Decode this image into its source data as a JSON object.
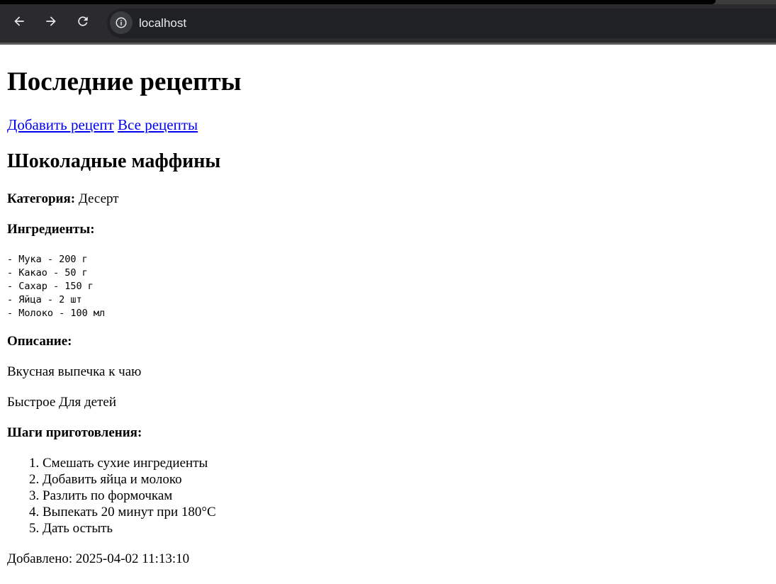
{
  "browser": {
    "url": "localhost",
    "back_icon": "arrow-left-icon",
    "forward_icon": "arrow-right-icon",
    "reload_icon": "reload-icon",
    "info_icon": "info-icon"
  },
  "page": {
    "title": "Последние рецепты",
    "nav_links": [
      "Добавить рецепт",
      "Все рецепты"
    ],
    "recipe": {
      "name": "Шоколадные маффины",
      "category_label": "Категория:",
      "category_value": "Десерт",
      "ingredients_label": "Ингредиенты:",
      "ingredients": [
        "- Мука - 200 г",
        "- Какао - 50 г",
        "- Сахар - 150 г",
        "- Яйца - 2 шт",
        "- Молоко - 100 мл"
      ],
      "description_label": "Описание:",
      "description": "Вкусная выпечка к чаю",
      "tags": "Быстрое Для детей",
      "steps_label": "Шаги приготовления:",
      "steps": [
        "Смешать сухие ингредиенты",
        "Добавить яйца и молоко",
        "Разлить по формочкам",
        "Выпекать 20 минут при 180°C",
        "Дать остыть"
      ],
      "added": "Добавлено: 2025-04-02 11:13:10"
    }
  }
}
